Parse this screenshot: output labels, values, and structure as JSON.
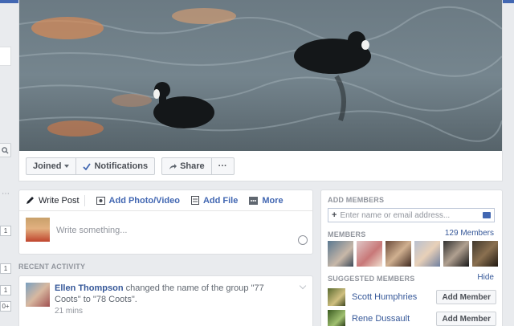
{
  "colors": {
    "brand": "#4267b2",
    "link": "#365899"
  },
  "left_rail": {
    "badges": [
      "1",
      "1",
      "1",
      "0+"
    ],
    "dots": "⋯"
  },
  "cover_actions": {
    "joined_label": "Joined",
    "notifications_label": "Notifications",
    "share_label": "Share",
    "more_label": "···"
  },
  "composer": {
    "tabs": [
      {
        "label": "Write Post",
        "icon": "pencil-icon"
      },
      {
        "label": "Add Photo/Video",
        "icon": "camera-icon"
      },
      {
        "label": "Add File",
        "icon": "file-icon"
      },
      {
        "label": "More",
        "icon": "more-icon"
      }
    ],
    "placeholder": "Write something..."
  },
  "recent_activity": {
    "heading": "RECENT ACTIVITY",
    "item": {
      "name": "Ellen Thompson",
      "text": " changed the name of the group \"77 Coots\" to \"78 Coots\".",
      "time": "21 mins"
    }
  },
  "sidebar": {
    "add_members_heading": "ADD MEMBERS",
    "add_members_placeholder": "Enter name or email address...",
    "members_heading": "MEMBERS",
    "members_count": "129 Members",
    "suggested_heading": "SUGGESTED MEMBERS",
    "hide_label": "Hide",
    "suggested": [
      {
        "name": "Scott Humphries",
        "button": "Add Member"
      },
      {
        "name": "Rene Dussault",
        "button": "Add Member"
      }
    ]
  }
}
